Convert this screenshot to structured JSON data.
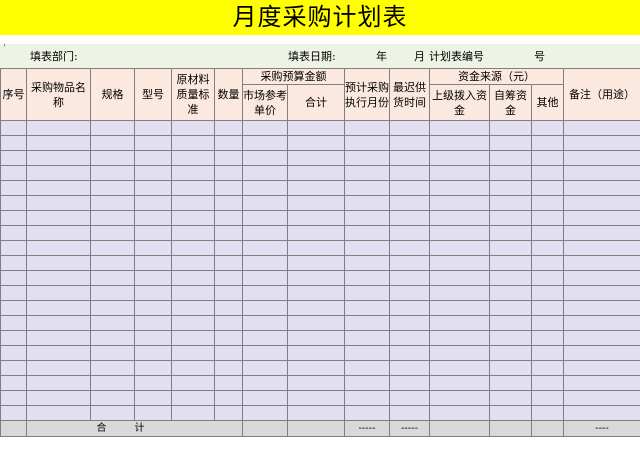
{
  "title": "月度采购计划表",
  "meta": {
    "dept_label": "填表部门:",
    "date_label": "填表日期:",
    "year_label": "年",
    "month_label": "月",
    "plan_no_label": "计划表编号",
    "no_suffix": "号"
  },
  "headers": {
    "seq": "序号",
    "item_name": "采购物品名称",
    "spec": "规格",
    "model": "型号",
    "quality_std": "原材料质量标准",
    "qty": "数量",
    "budget_group": "采购预算金额",
    "market_price": "市场参考单价",
    "subtotal": "合计",
    "planned_month": "预计采购执行月份",
    "latest_supply": "最迟供货时间",
    "fund_group": "资金来源（元）",
    "superior_fund": "上级拨入资金",
    "self_fund": "自筹资金",
    "other": "其他",
    "remarks": "备注（用途）"
  },
  "row_count": 20,
  "footer": {
    "total_label": "合计",
    "dash_total": "-----",
    "dash_month": "-----",
    "dash_supply": "-----",
    "dash_remarks": "----"
  },
  "colors": {
    "title_bg": "#ffff00",
    "header_bg": "#fbe9df",
    "body_bg": "#e2dff0",
    "footer_bg": "#d9d9d9",
    "meta_bg": "#eef3e6"
  }
}
